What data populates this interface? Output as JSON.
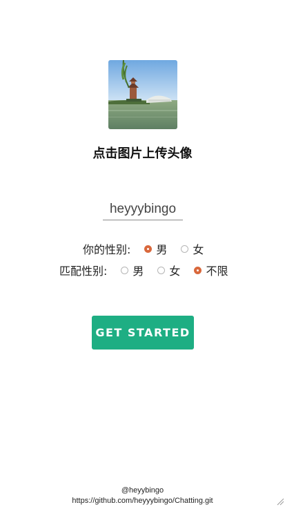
{
  "avatar": {
    "icon": "landscape-photo",
    "alt": ""
  },
  "upload_label": "点击图片上传头像",
  "name_input": {
    "value": "heyyybingo",
    "placeholder": ""
  },
  "my_gender": {
    "label": "你的性别:",
    "options": [
      {
        "label": "男",
        "checked": true
      },
      {
        "label": "女",
        "checked": false
      }
    ]
  },
  "match_gender": {
    "label": "匹配性别:",
    "options": [
      {
        "label": "男",
        "checked": false
      },
      {
        "label": "女",
        "checked": false
      },
      {
        "label": "不限",
        "checked": true
      }
    ]
  },
  "start_button": "GET STARTED",
  "footer": {
    "author": "@heyybingo",
    "repo_url": "https://github.com/heyyybingo/Chatting.git"
  },
  "colors": {
    "accent": "#1eae83",
    "radio_checked": "#d9683c",
    "text": "#111111"
  }
}
